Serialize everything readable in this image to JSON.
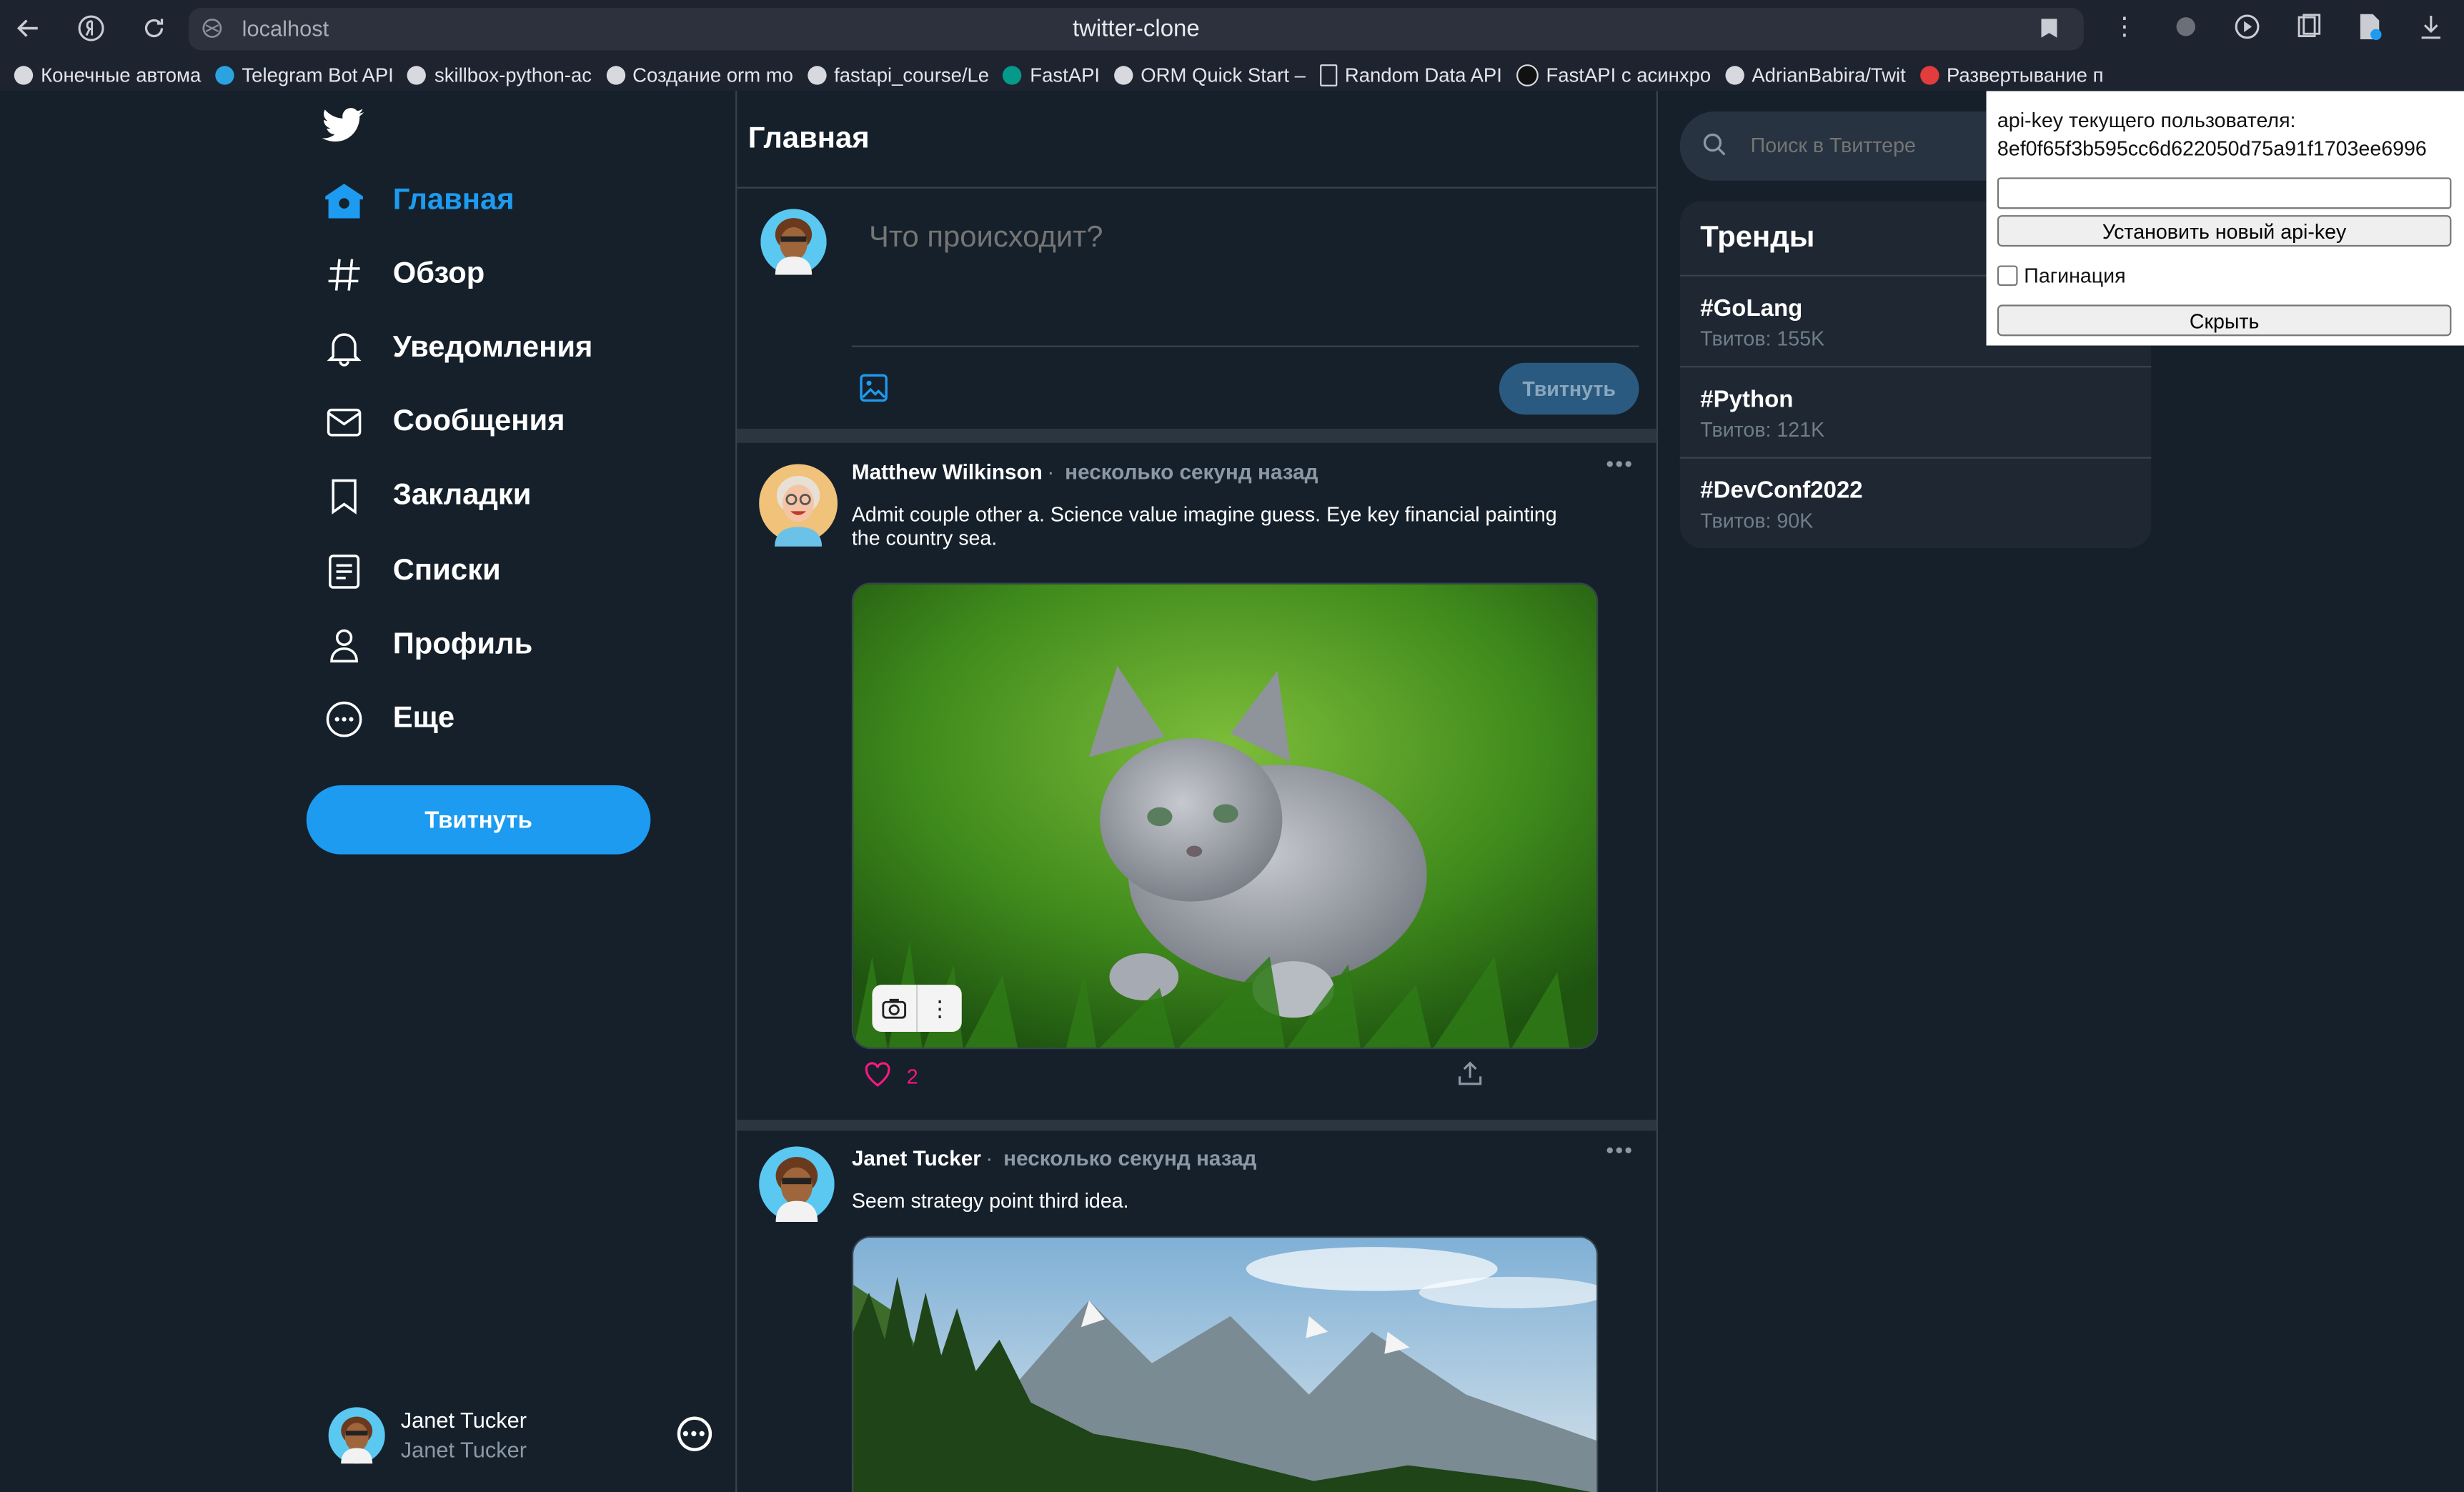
{
  "browser": {
    "url": "localhost",
    "title": "twitter-clone",
    "bookmarks": [
      "Конечные автома",
      "Telegram Bot API",
      "skillbox-python-ac",
      "Создание orm mo",
      "fastapi_course/Le",
      "FastAPI",
      "ORM Quick Start –",
      "Random Data API",
      "FastAPI с асинхро",
      "AdrianBabira/Twit",
      "Развертывание п"
    ]
  },
  "sidebar": {
    "items": [
      {
        "label": "Главная",
        "icon": "home-icon",
        "active": true
      },
      {
        "label": "Обзор",
        "icon": "hashtag-icon"
      },
      {
        "label": "Уведомления",
        "icon": "bell-icon"
      },
      {
        "label": "Сообщения",
        "icon": "mail-icon"
      },
      {
        "label": "Закладки",
        "icon": "bookmark-icon"
      },
      {
        "label": "Списки",
        "icon": "list-icon"
      },
      {
        "label": "Профиль",
        "icon": "user-icon"
      },
      {
        "label": "Еще",
        "icon": "more-circle-icon"
      }
    ],
    "tweet_button": "Твитнуть",
    "account": {
      "name": "Janet Tucker",
      "handle": "Janet Tucker"
    }
  },
  "main": {
    "title": "Главная",
    "compose": {
      "placeholder": "Что происходит?",
      "submit": "Твитнуть"
    },
    "tweets": [
      {
        "author": "Matthew Wilkinson",
        "time": "несколько секунд назад",
        "text": "Admit couple other a. Science value imagine guess. Eye key financial painting the country sea.",
        "image": "kitten-photo",
        "likes": "2"
      },
      {
        "author": "Janet Tucker",
        "time": "несколько секунд назад",
        "text": "Seem strategy point third idea.",
        "image": "mountain-lake-photo"
      }
    ]
  },
  "right": {
    "search_placeholder": "Поиск в Твиттере",
    "trends_title": "Тренды",
    "trends": [
      {
        "tag": "#GoLang",
        "count": "Твитов: 155K"
      },
      {
        "tag": "#Python",
        "count": "Твитов: 121K"
      },
      {
        "tag": "#DevConf2022",
        "count": "Твитов: 90K"
      }
    ]
  },
  "api_panel": {
    "label": "api-key текущего пользователя:",
    "value": "8ef0f65f3b595cc6d622050d75a91f1703ee6996",
    "set_button": "Установить новый api-key",
    "pagination_label": "Пагинация",
    "hide_button": "Скрыть"
  },
  "colors": {
    "accent": "#1d9bf0",
    "background": "#15202b",
    "like": "#f91880"
  }
}
